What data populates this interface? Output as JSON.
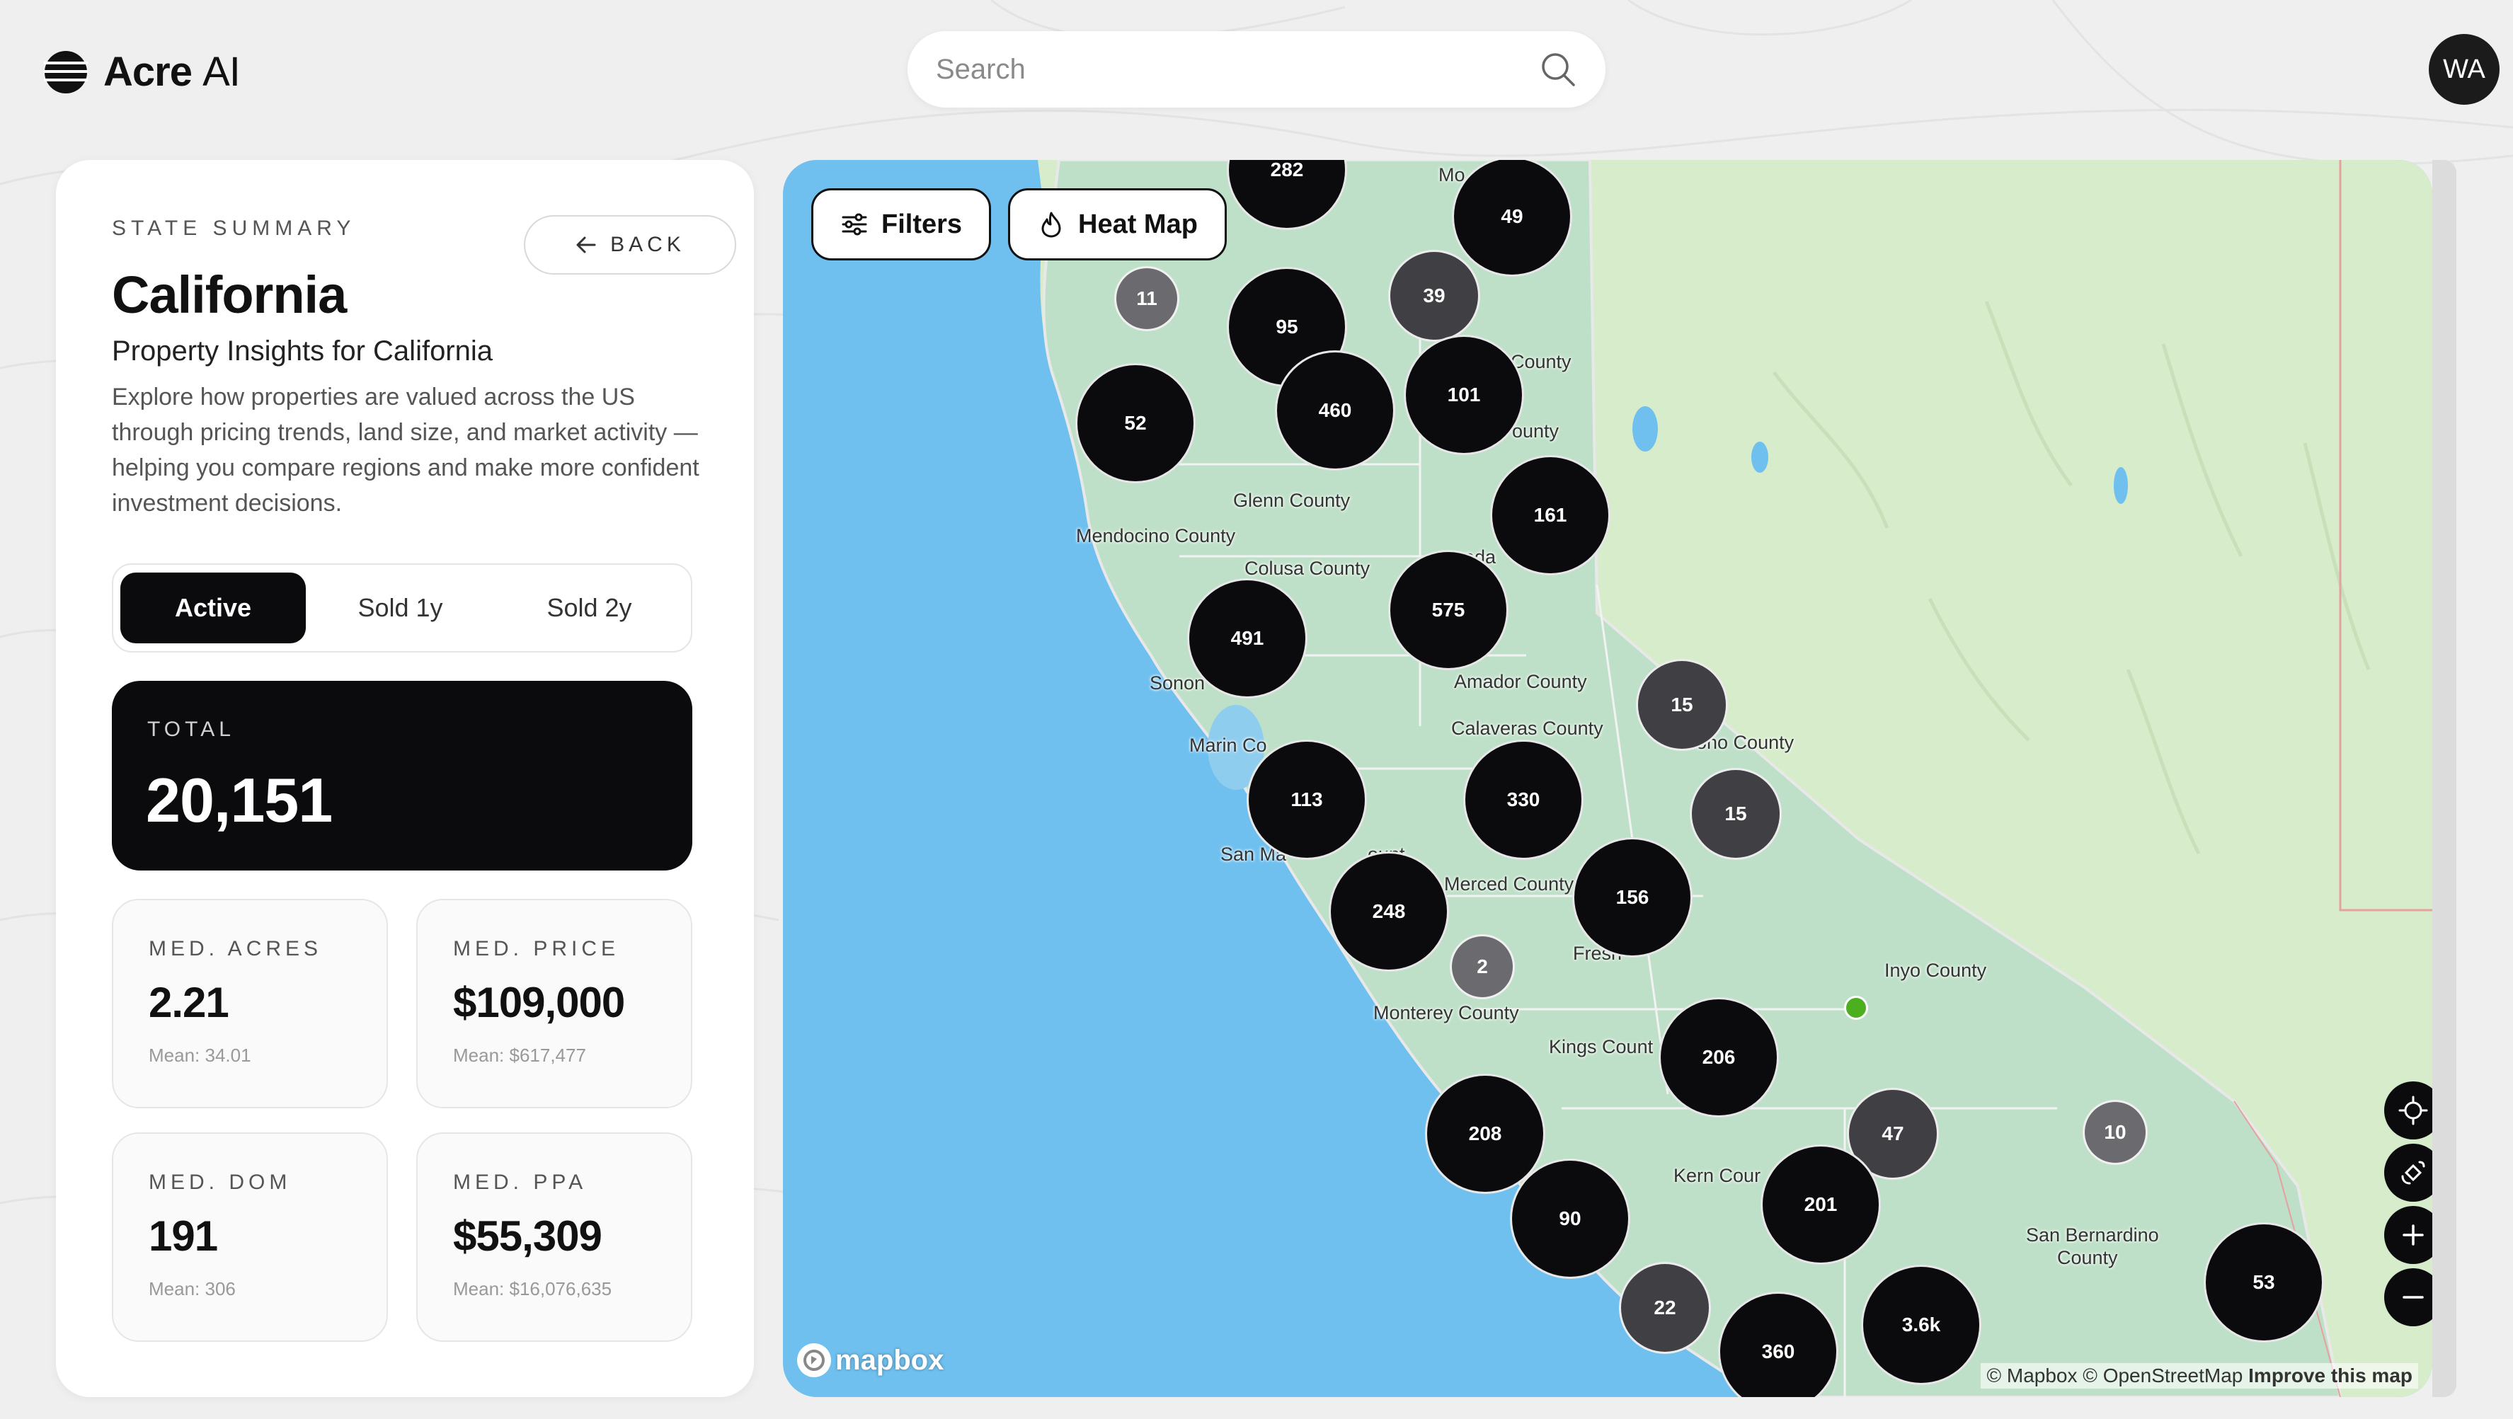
{
  "app": {
    "brand": "Acre",
    "brand_suffix": "AI",
    "search_placeholder": "Search",
    "user_initials": "WA"
  },
  "panel": {
    "eyebrow": "STATE SUMMARY",
    "back_label": "BACK",
    "state": "California",
    "subtitle": "Property Insights for California",
    "description": "Explore how properties are valued across the US through pricing trends, land size, and market activity — helping you compare regions and make more confident investment decisions.",
    "tabs": [
      {
        "label": "Active",
        "selected": true
      },
      {
        "label": "Sold 1y",
        "selected": false
      },
      {
        "label": "Sold 2y",
        "selected": false
      }
    ],
    "total": {
      "label": "TOTAL",
      "value": "20,151"
    },
    "stats": [
      {
        "label": "MED. ACRES",
        "value": "2.21",
        "mean": "Mean: 34.01"
      },
      {
        "label": "MED. PRICE",
        "value": "$109,000",
        "mean": "Mean: $617,477"
      },
      {
        "label": "MED. DOM",
        "value": "191",
        "mean": "Mean: 306"
      },
      {
        "label": "MED. PPA",
        "value": "$55,309",
        "mean": "Mean: $16,076,635"
      }
    ]
  },
  "map": {
    "filters_label": "Filters",
    "heatmap_label": "Heat Map",
    "mapbox_label": "mapbox",
    "attribution": {
      "mapbox": "© Mapbox",
      "osm": "© OpenStreetMap",
      "improve": "Improve this map"
    },
    "clusters": [
      "282",
      "49",
      "11",
      "39",
      "95",
      "460",
      "101",
      "52",
      "161",
      "575",
      "491",
      "15",
      "113",
      "330",
      "15",
      "156",
      "248",
      "2",
      "206",
      "208",
      "47",
      "10",
      "90",
      "201",
      "53",
      "22",
      "360",
      "3.6k"
    ],
    "county_labels": [
      "Glenn County",
      "Mendocino County",
      "Colusa County",
      "Amador County",
      "Calaveras County",
      "Marin Co",
      "Sonon",
      "San Ma",
      "Merced County",
      "Fresn",
      "Monterey County",
      "Kings Count",
      "Kern Cour",
      "Inyo County",
      "San Bernardino",
      "County",
      "County",
      "ounty",
      "ono County",
      "Mo",
      "ada",
      "ount"
    ],
    "colors": {
      "ocean": "#6fc0ef",
      "land": "#cfe8c8",
      "california": "#b9dcc4",
      "cluster_dark": "#0b0b0d",
      "cluster_mid": "#404044",
      "marker_green": "#4caf20"
    }
  }
}
